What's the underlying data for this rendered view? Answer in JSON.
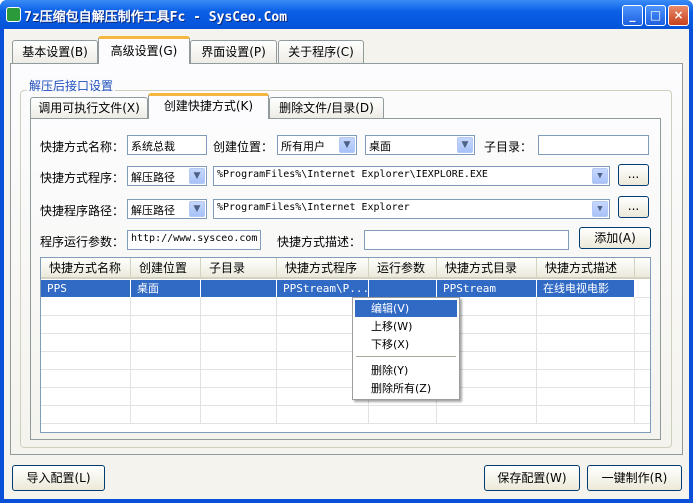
{
  "window": {
    "title": "7z压缩包自解压制作工具Fc - SysCeo.Com",
    "controls": [
      "_",
      "□",
      "×"
    ]
  },
  "tabs": [
    {
      "label": "基本设置(B)"
    },
    {
      "label": "高级设置(G)",
      "selected": true
    },
    {
      "label": "界面设置(P)"
    },
    {
      "label": "关于程序(C)"
    }
  ],
  "group": {
    "label": "解压后接口设置"
  },
  "subtabs": [
    {
      "label": "调用可执行文件(X)"
    },
    {
      "label": "创建快捷方式(K)",
      "selected": true
    },
    {
      "label": "删除文件/目录(D)"
    }
  ],
  "form": {
    "name_label": "快捷方式名称：",
    "name_value": "系统总裁",
    "location_label": "创建位置：",
    "location_user": "所有用户",
    "location_place": "桌面",
    "subdir_label": "子目录：",
    "subdir_value": "",
    "program_label": "快捷方式程序：",
    "program_base": "解压路径",
    "program_value": "%ProgramFiles%\\Internet Explorer\\IEXPLORE.EXE",
    "path_label": "快捷程序路径：",
    "path_base": "解压路径",
    "path_value": "%ProgramFiles%\\Internet Explorer",
    "args_label": "程序运行参数：",
    "args_value": "http://www.sysceo.com",
    "desc_label": "快捷方式描述：",
    "desc_value": "",
    "browse_label": "...",
    "add_label": "添加(A)"
  },
  "table": {
    "columns": [
      "快捷方式名称",
      "创建位置",
      "子目录",
      "快捷方式程序",
      "运行参数",
      "快捷方式目录",
      "快捷方式描述"
    ],
    "rows": [
      [
        "PPS",
        "桌面",
        "",
        "PPStream\\P...",
        "",
        "PPStream",
        "在线电视电影"
      ]
    ]
  },
  "context_menu": {
    "items": [
      "编辑(V)",
      "上移(W)",
      "下移(X)",
      "删除(Y)",
      "删除所有(Z)"
    ]
  },
  "footer": {
    "import_label": "导入配置(L)",
    "save_label": "保存配置(W)",
    "build_label": "一键制作(R)"
  },
  "colors": {
    "selection": "#316ac5",
    "titlebar": "#0a5fe6",
    "tab_accent": "#f5b740"
  }
}
